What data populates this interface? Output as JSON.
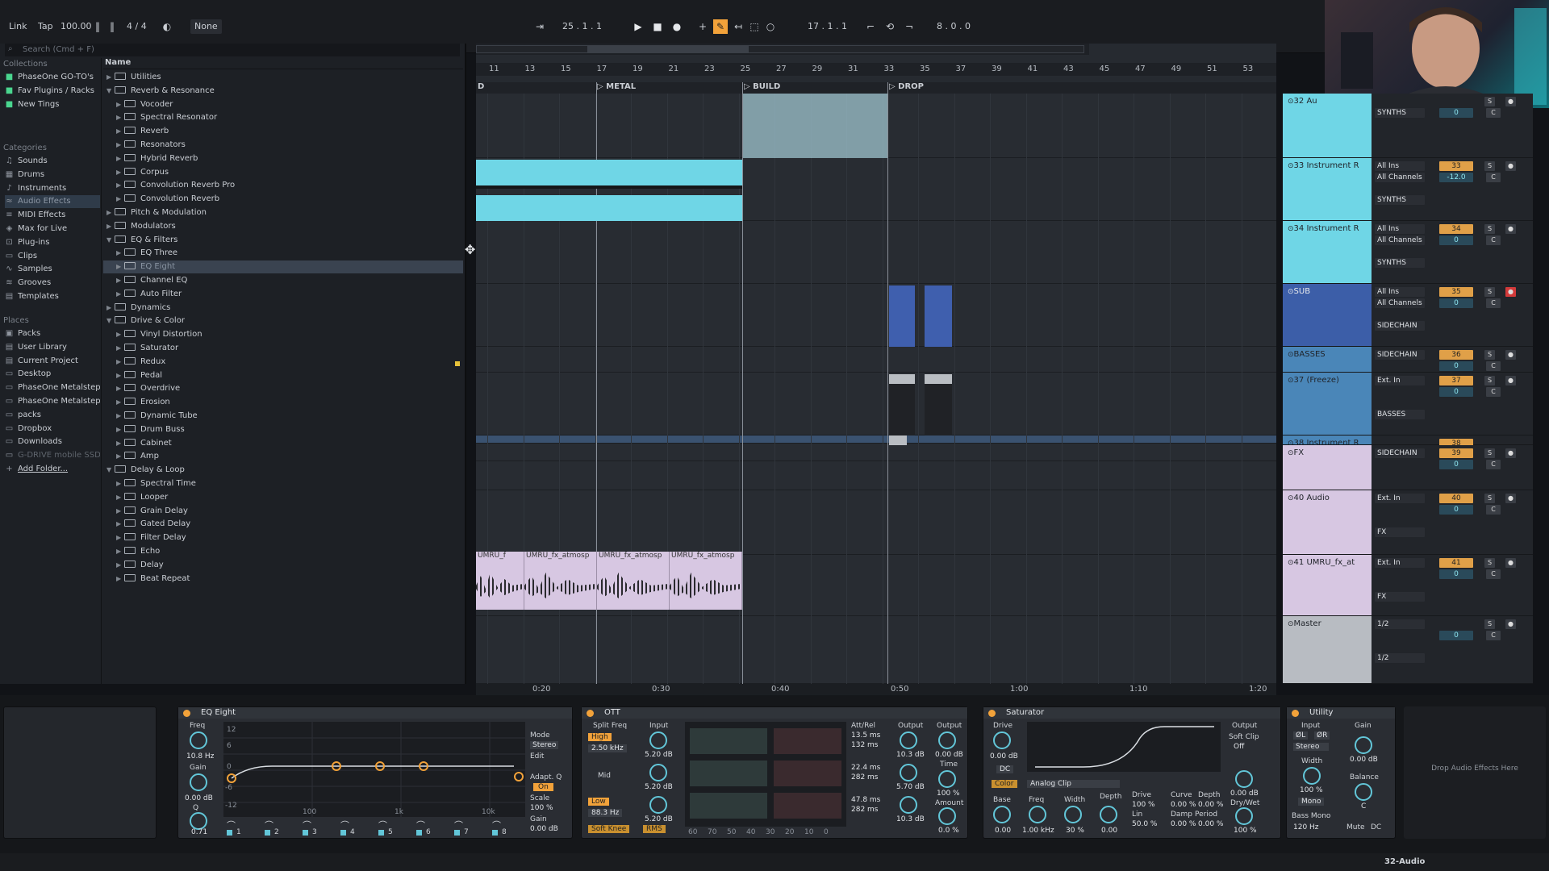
{
  "transport": {
    "link": "Link",
    "tap": "Tap",
    "tempo": "100.00",
    "meter": "4 / 4",
    "metro": "None",
    "position": "25 .  1 .  1",
    "loop_start": "17 .  1 .  1",
    "loop_len": "8 .  0 .  0"
  },
  "browser": {
    "search_placeholder": "Search (Cmd + F)",
    "collections_label": "Collections",
    "collections": [
      "PhaseOne GO-TO's",
      "Fav Plugins / Racks",
      "New Tings"
    ],
    "categories_label": "Categories",
    "categories": [
      "Sounds",
      "Drums",
      "Instruments",
      "Audio Effects",
      "MIDI Effects",
      "Max for Live",
      "Plug-ins",
      "Clips",
      "Samples",
      "Grooves",
      "Templates"
    ],
    "places_label": "Places",
    "places": [
      "Packs",
      "User Library",
      "Current Project",
      "Desktop",
      "PhaseOne Metalstep",
      "PhaseOne Metalstep",
      "packs",
      "Dropbox",
      "Downloads",
      "G-DRIVE mobile SSD",
      "Add Folder..."
    ],
    "name_header": "Name",
    "items": [
      {
        "label": "Utilities",
        "level": 0,
        "open": false
      },
      {
        "label": "Reverb & Resonance",
        "level": 0,
        "open": true
      },
      {
        "label": "Vocoder",
        "level": 1
      },
      {
        "label": "Spectral Resonator",
        "level": 1
      },
      {
        "label": "Reverb",
        "level": 1
      },
      {
        "label": "Resonators",
        "level": 1
      },
      {
        "label": "Hybrid Reverb",
        "level": 1
      },
      {
        "label": "Corpus",
        "level": 1
      },
      {
        "label": "Convolution Reverb Pro",
        "level": 1
      },
      {
        "label": "Convolution Reverb",
        "level": 1
      },
      {
        "label": "Pitch & Modulation",
        "level": 0
      },
      {
        "label": "Modulators",
        "level": 0
      },
      {
        "label": "EQ & Filters",
        "level": 0,
        "open": true
      },
      {
        "label": "EQ Three",
        "level": 1
      },
      {
        "label": "EQ Eight",
        "level": 1,
        "selected": true
      },
      {
        "label": "Channel EQ",
        "level": 1
      },
      {
        "label": "Auto Filter",
        "level": 1
      },
      {
        "label": "Dynamics",
        "level": 0
      },
      {
        "label": "Drive & Color",
        "level": 0,
        "open": true
      },
      {
        "label": "Vinyl Distortion",
        "level": 1
      },
      {
        "label": "Saturator",
        "level": 1
      },
      {
        "label": "Redux",
        "level": 1
      },
      {
        "label": "Pedal",
        "level": 1
      },
      {
        "label": "Overdrive",
        "level": 1
      },
      {
        "label": "Erosion",
        "level": 1
      },
      {
        "label": "Dynamic Tube",
        "level": 1
      },
      {
        "label": "Drum Buss",
        "level": 1
      },
      {
        "label": "Cabinet",
        "level": 1
      },
      {
        "label": "Amp",
        "level": 1
      },
      {
        "label": "Delay & Loop",
        "level": 0,
        "open": true
      },
      {
        "label": "Spectral Time",
        "level": 1
      },
      {
        "label": "Looper",
        "level": 1
      },
      {
        "label": "Grain Delay",
        "level": 1
      },
      {
        "label": "Gated Delay",
        "level": 1
      },
      {
        "label": "Filter Delay",
        "level": 1
      },
      {
        "label": "Echo",
        "level": 1
      },
      {
        "label": "Delay",
        "level": 1
      },
      {
        "label": "Beat Repeat",
        "level": 1
      }
    ]
  },
  "ruler": [
    "11",
    "13",
    "15",
    "17",
    "19",
    "21",
    "23",
    "25",
    "27",
    "29",
    "31",
    "33",
    "35",
    "37",
    "39",
    "41",
    "43",
    "45",
    "47",
    "49",
    "51",
    "53"
  ],
  "locators": {
    "d": "D",
    "metal": "METAL",
    "build": "BUILD",
    "drop": "DROP"
  },
  "timeline": [
    "0:20",
    "0:30",
    "0:40",
    "0:50",
    "1:00",
    "1:10",
    "1:20"
  ],
  "clip_labels": [
    "UMRU_f",
    "UMRU_fx_atmosp",
    "UMRU_fx_atmosp",
    "UMRU_fx_atmosp"
  ],
  "tracks": [
    {
      "name": "32 Au",
      "color": "#6fd6e6",
      "in": "",
      "ch": "SYNTHS",
      "num": "",
      "vol": "0",
      "pan": "C"
    },
    {
      "name": "33 Instrument R",
      "color": "#6fd6e6",
      "in": "All Ins",
      "ch": "All Channels",
      "out": "SYNTHS",
      "num": "33",
      "vol": "-12.0",
      "pan": "C"
    },
    {
      "name": "34 Instrument R",
      "color": "#6fd6e6",
      "in": "All Ins",
      "ch": "All Channels",
      "out": "SYNTHS",
      "num": "34",
      "vol": "0",
      "pan": "C"
    },
    {
      "name": "SUB",
      "color": "#3c5ea8",
      "in": "All Ins",
      "ch": "All Channels",
      "out": "SIDECHAIN",
      "num": "35",
      "vol": "0",
      "pan": "C"
    },
    {
      "name": "BASSES",
      "color": "#4a86b8",
      "in": "SIDECHAIN",
      "num": "36",
      "vol": "0",
      "pan": "C"
    },
    {
      "name": "37 (Freeze)",
      "color": "#4a86b8",
      "in": "Ext. In",
      "out": "BASSES",
      "num": "37",
      "vol": "0",
      "pan": "C"
    },
    {
      "name": "38 Instrument R",
      "color": "#4a86b8",
      "num": "38"
    },
    {
      "name": "FX",
      "color": "#d7c7e2",
      "in": "SIDECHAIN",
      "num": "39",
      "vol": "0",
      "pan": "C"
    },
    {
      "name": "40 Audio",
      "color": "#d7c7e2",
      "in": "Ext. In",
      "out": "FX",
      "num": "40",
      "vol": "0",
      "pan": "C"
    },
    {
      "name": "41 UMRU_fx_at",
      "color": "#d7c7e2",
      "in": "Ext. In",
      "out": "FX",
      "num": "41",
      "vol": "0",
      "pan": "C"
    },
    {
      "name": "Master",
      "color": "#b8bcc2",
      "in": "1/2",
      "out": "1/2",
      "vol": "0",
      "pan": "C"
    }
  ],
  "devices": {
    "eq": {
      "title": "EQ Eight",
      "freq_label": "Freq",
      "freq": "10.8 Hz",
      "gain_label": "Gain",
      "gain": "0.00 dB",
      "q_label": "Q",
      "q": "0.71",
      "mode_label": "Mode",
      "mode": "Stereo",
      "edit_label": "Edit",
      "adapt_label": "Adapt. Q",
      "adapt": "On",
      "scale_label": "Scale",
      "scale": "100 %",
      "outgain_label": "Gain",
      "outgain": "0.00 dB",
      "bands": [
        "1",
        "2",
        "3",
        "4",
        "5",
        "6",
        "7",
        "8"
      ],
      "db_ticks": [
        "12",
        "6",
        "0",
        "-6",
        "-12"
      ],
      "hz_ticks": [
        "100",
        "1k",
        "10k"
      ]
    },
    "ott": {
      "title": "OTT",
      "split_label": "Split Freq",
      "input_label": "Input",
      "high": "High",
      "high_freq": "2.50 kHz",
      "mid": "Mid",
      "low": "Low",
      "low_freq": "88.3 Hz",
      "softknee": "Soft Knee",
      "rms": "RMS",
      "in_high": "5.20 dB",
      "in_mid": "5.20 dB",
      "in_low": "5.20 dB",
      "attrel": "Att/Rel",
      "t1": "13.5 ms",
      "t2": "132 ms",
      "t3": "22.4 ms",
      "t4": "282 ms",
      "t5": "47.8 ms",
      "t6": "282 ms",
      "output_label": "Output",
      "out1": "10.3 dB",
      "out2": "5.70 dB",
      "out3": "10.3 dB",
      "output2_label": "Output",
      "out_main": "0.00 dB",
      "time_label": "Time",
      "time": "100 %",
      "amount_label": "Amount",
      "amount": "0.0 %",
      "scale": [
        "60",
        "70",
        "50",
        "40",
        "30",
        "20",
        "10",
        "0"
      ]
    },
    "sat": {
      "title": "Saturator",
      "drive_label": "Drive",
      "drive": "0.00 dB",
      "dc": "DC",
      "color_btn": "Color",
      "type": "Analog Clip",
      "output_label": "Output",
      "softclip_label": "Soft Clip",
      "softclip": "Off",
      "output_val": "0.00 dB",
      "drywet_label": "Dry/Wet",
      "drywet": "100 %",
      "base_label": "Base",
      "base": "0.00",
      "freq_label": "Freq",
      "freq": "1.00 kHz",
      "width_label": "Width",
      "width": "30 %",
      "depth_label": "Depth",
      "depth": "0.00",
      "drive2_label": "Drive",
      "drive2": "100 %",
      "lin": "Lin",
      "lin_val": "50.0 %",
      "curve_label": "Curve",
      "curve": "0.00 %",
      "damp": "Damp",
      "damp_val": "0.00 %",
      "depth2_label": "Depth",
      "depth2": "0.00 %",
      "period": "Period",
      "period_val": "0.00 %"
    },
    "util": {
      "title": "Utility",
      "input_label": "Input",
      "phase_l": "ØL",
      "phase_r": "ØR",
      "stereo": "Stereo",
      "width_label": "Width",
      "width": "100 %",
      "mono": "Mono",
      "bassmono": "Bass Mono",
      "bassfreq": "120 Hz",
      "gain_label": "Gain",
      "gain": "0.00 dB",
      "balance_label": "Balance",
      "balance": "C",
      "mute": "Mute",
      "dc": "DC"
    },
    "drop_text": "Drop Audio Effects Here"
  },
  "status": {
    "track": "32-Audio"
  }
}
